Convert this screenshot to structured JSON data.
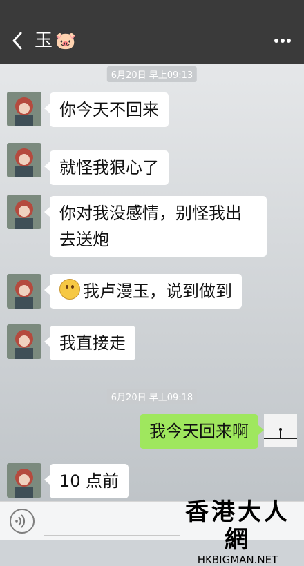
{
  "header": {
    "title": "玉",
    "title_emoji": "🐷",
    "back_icon": "chevron-left-icon",
    "more_icon": "more-horizontal-icon"
  },
  "chat": {
    "timestamps": [
      "6月20日 早上09:13",
      "6月20日 早上09:18"
    ],
    "messages": [
      {
        "from": "other",
        "text": "你今天不回来"
      },
      {
        "from": "other",
        "text": "就怪我狠心了"
      },
      {
        "from": "other",
        "text": "你对我没感情，别怪我出去送炮"
      },
      {
        "from": "other",
        "text": "我卢漫玉，说到做到",
        "emoji": "smile-emoji"
      },
      {
        "from": "other",
        "text": "我直接走"
      },
      {
        "from": "me",
        "text": "我今天回来啊"
      },
      {
        "from": "other",
        "text": "10 点前"
      }
    ]
  },
  "watermark": {
    "cn": "香港大人網",
    "en": "HKBIGMAN.NET"
  },
  "colors": {
    "header_bg": "#3a3a3a",
    "bubble_me": "#9fe75e",
    "bubble_other": "#ffffff"
  }
}
